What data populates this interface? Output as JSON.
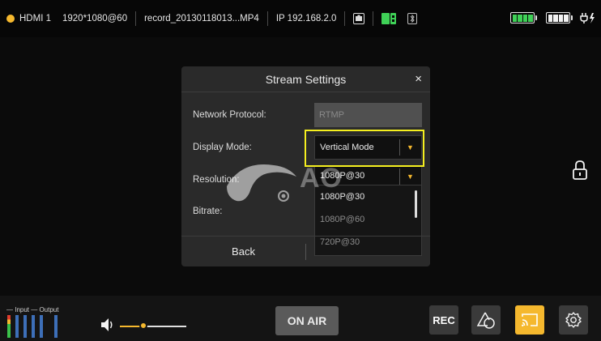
{
  "status_bar": {
    "source": "HDMI 1",
    "resolution": "1920*1080@60",
    "filename": "record_20130118013...MP4",
    "ip": "IP 192.168.2.0"
  },
  "dialog": {
    "title": "Stream Settings",
    "close": "×",
    "labels": {
      "protocol": "Network Protocol:",
      "display_mode": "Display Mode:",
      "resolution": "Resolution:",
      "bitrate": "Bitrate:"
    },
    "protocol_value": "RTMP",
    "display_mode_value": "Vertical Mode",
    "resolution_value": "1080P@30",
    "resolution_options": [
      "1080P@30",
      "1080P@60",
      "720P@30"
    ],
    "back": "Back"
  },
  "watermark": {
    "text": "AO"
  },
  "bottom_bar": {
    "io_label": "— Input — Output",
    "volume_level": 0.35,
    "onair": "ON AIR",
    "rec": "REC"
  },
  "colors": {
    "accent": "#f5b82e",
    "highlight": "#f5ef1f",
    "battery": "#3fd157"
  }
}
